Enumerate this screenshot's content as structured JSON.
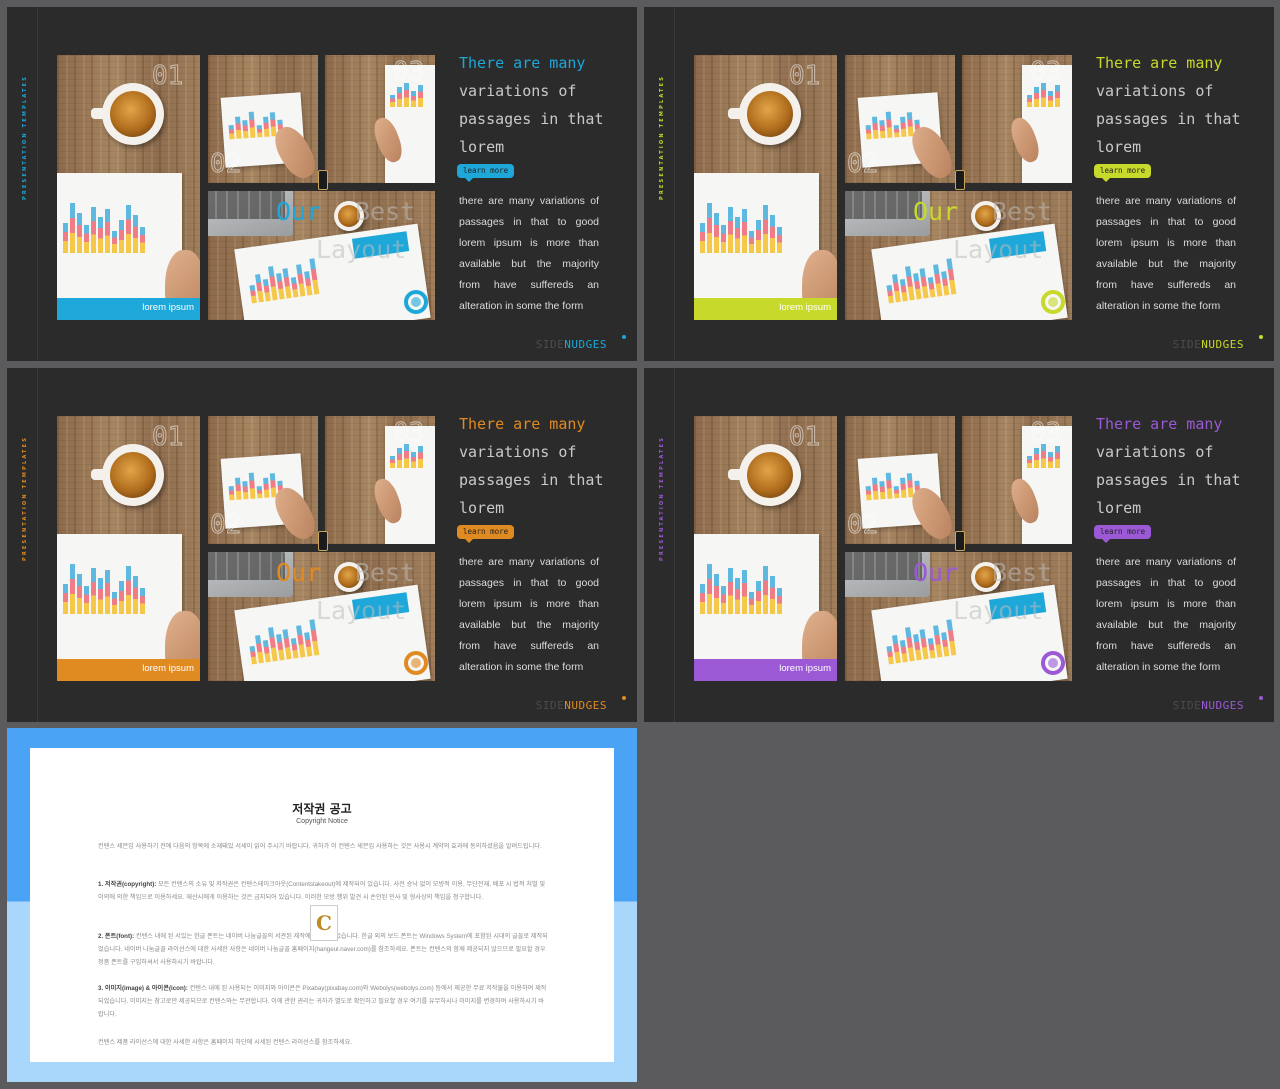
{
  "slides": [
    {
      "accent": "#1ea7d9"
    },
    {
      "accent": "#c7d92a"
    },
    {
      "accent": "#e08a22"
    },
    {
      "accent": "#9b59d6"
    }
  ],
  "slide_text": {
    "vertical_label": "PRESENTATION TEMPLATES",
    "num_01": "01",
    "num_02": "02",
    "num_03": "03",
    "tag_label": "lorem ipsum",
    "ghost_our": "Our",
    "ghost_best": "Best",
    "ghost_layout": "Layout",
    "heading": "There are many variations of passages in that lorem",
    "heading_first": "There are many",
    "heading_rest": "variations of passages in that lorem",
    "learn_more": "learn more",
    "body": "there are many variations of passages in that to good lorem ipsum is more than available but the majority from have suffereds an alteration in some the form",
    "brand_side": "SIDE",
    "brand_nudges": "NUDGES"
  },
  "copyright": {
    "title": "저작권 공고",
    "subtitle": "Copyright Notice",
    "logo_letter": "C",
    "p_intro": "컨텐스 세븐입 사용하기 전에 다음의 항목에 소재돼있 서세이 읽어 주시기 바랍니다. 귀하가 이 컨텐스 세븐입 사용하는 것은 사용시 계약의 효과에 동의하셨음을 알려드립니다.",
    "p1_head": "1. 저작권(copyright):",
    "p1_body": "모든 컨텐스의 소유 및 저작권은 컨텐스테이크아웃(Contentstakeout)에 제작되어 있습니다. 사전 승낙 없이 모방적 이용, 무단전재, 배포 시 법적 처벌 및 이의에 의한 책임으로 이용하세요. 재산시에게 이용하는 것은 금지되어 있습니다. 이러한 모방 행위 발견 시 손인된 민사 및 형사상의 책임을 청구합니다.",
    "p2_head": "2. 폰트(font):",
    "p2_body": "컨텐스 내에 된 서있는 한글 폰트는 네이버 나눔글꼴의 서관된 제작에 재작되어있습니다. 한글 외의 보드 폰트는 Windows System에 포함된 시대의 글꼴로 제작되었습니다. 네이버 나눔글꼴 라이선스에 대한 사세한 사항은 네이버 나눔글꼴 홈페이지(hangeul.naver.com)를 참조하세요. 폰트는 컨텐스의 함께 제공되지 않으므로 필요할 경우 정품 폰트를 구입하셔서 사용하시기 바랍니다.",
    "p3_head": "3. 이미지(image) & 아이콘(icon):",
    "p3_body": "컨텐스 내에 된 사용되는 이미지와 아이콘은 Pixabay(pixabay.com)와 Webolys(webolys.com) 등에서 제공한 무료 저작물을 이용하여 제작되었습니다. 이미지는 참고로만 제공되므로 컨텐스와는 무관합니다. 이에 관한 권리는 귀하가 별도로 확인하고 필요할 경우 여기를 유무하시나 이미지를 변경하여 사용하시기 바랍니다.",
    "p_outro": "컨텐스 제품 라이선스에 대한 사세한 사항은 홈페이지 하단에 시세된 컨텐스 라이선스를 참조하세요."
  }
}
